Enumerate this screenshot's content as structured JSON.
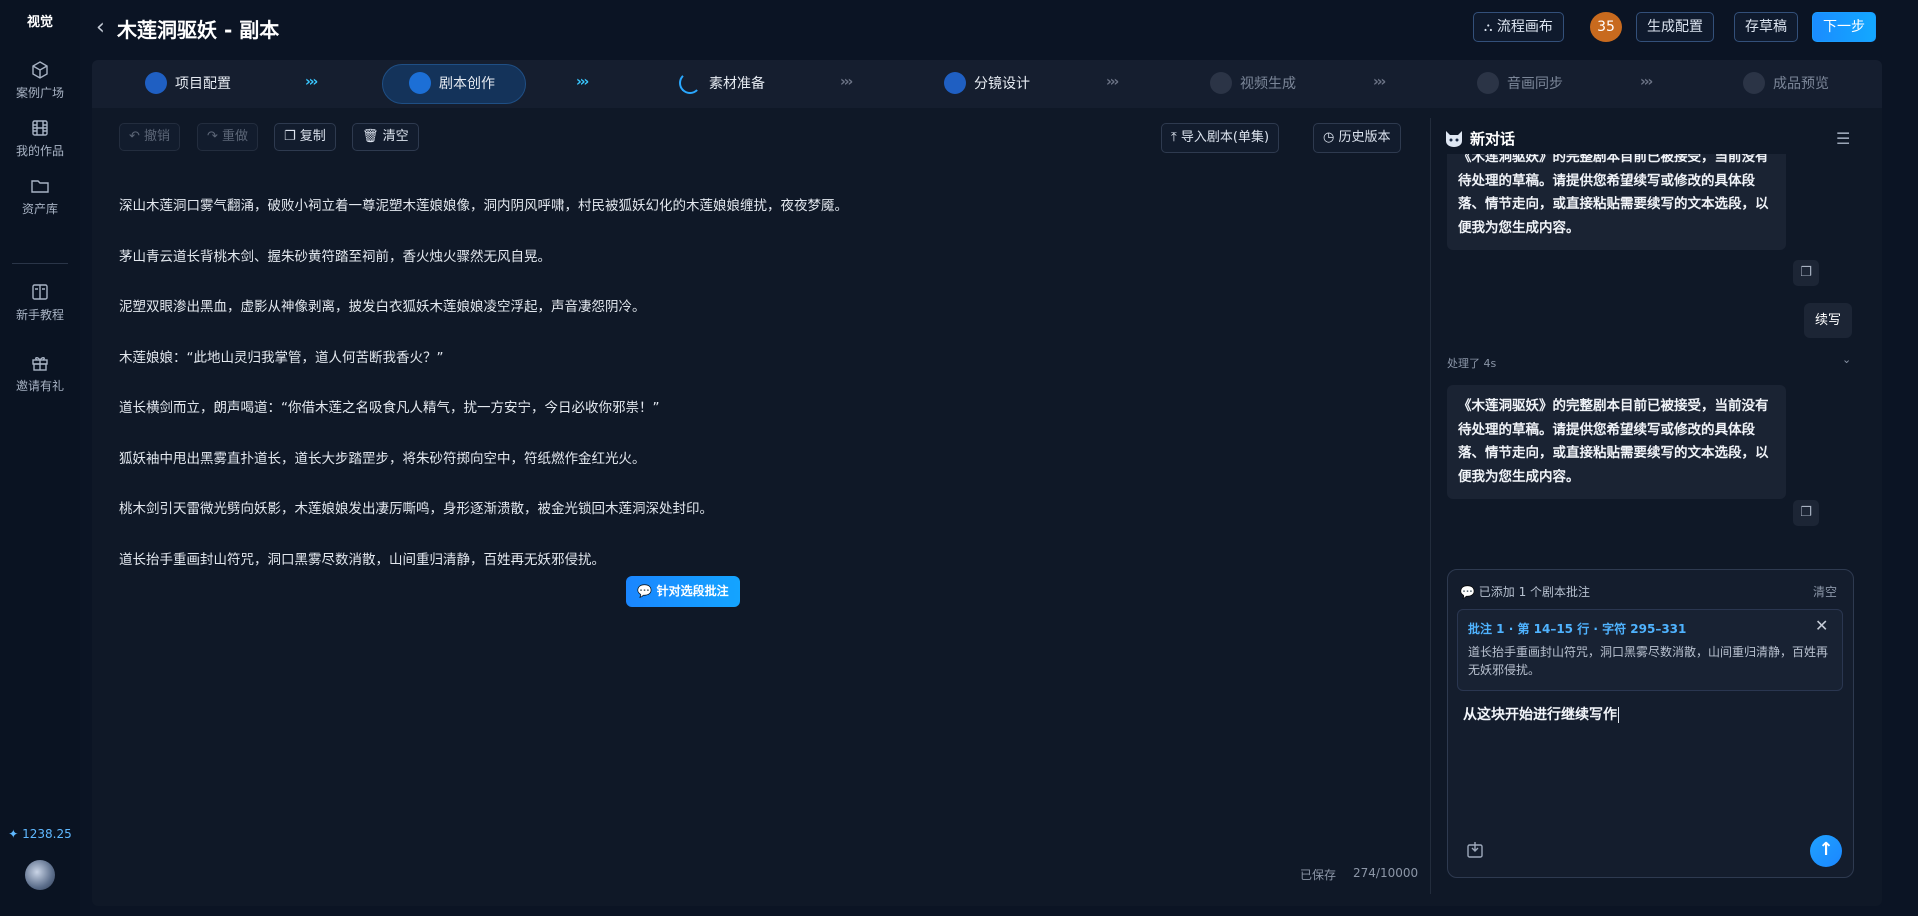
{
  "brand": "视觉",
  "sidebar": {
    "items": [
      {
        "label": "案例广场",
        "icon": "cube-icon"
      },
      {
        "label": "我的作品",
        "icon": "film-icon"
      },
      {
        "label": "资产库",
        "icon": "folder-icon"
      },
      {
        "label": "新手教程",
        "icon": "book-icon"
      },
      {
        "label": "邀请有礼",
        "icon": "gift-icon"
      }
    ],
    "credits": "1238.25"
  },
  "header": {
    "title": "木莲洞驱妖 - 副本",
    "flow_canvas": "流程画布",
    "badge_count": "35",
    "generate_config": "生成配置",
    "save_draft": "存草稿",
    "next_step": "下一步"
  },
  "steps": [
    {
      "label": "项目配置",
      "state": "done"
    },
    {
      "label": "剧本创作",
      "state": "active"
    },
    {
      "label": "素材准备",
      "state": "loading"
    },
    {
      "label": "分镜设计",
      "state": "done"
    },
    {
      "label": "视频生成",
      "state": "pending"
    },
    {
      "label": "音画同步",
      "state": "pending"
    },
    {
      "label": "成品预览",
      "state": "pending"
    }
  ],
  "editor": {
    "toolbar": {
      "undo": "撤销",
      "redo": "重做",
      "copy": "复制",
      "clear": "清空",
      "import": "导入剧本(单集)",
      "history": "历史版本"
    },
    "paragraphs": [
      "深山木莲洞口雾气翻涌，破败小祠立着一尊泥塑木莲娘娘像，洞内阴风呼啸，村民被狐妖幻化的木莲娘娘缠扰，夜夜梦魇。",
      "茅山青云道长背桃木剑、握朱砂黄符踏至祠前，香火烛火骤然无风自晃。",
      "泥塑双眼渗出黑血，虚影从神像剥离，披发白衣狐妖木莲娘娘凌空浮起，声音凄怨阴冷。",
      "木莲娘娘：“此地山灵归我掌管，道人何苦断我香火？”",
      "道长横剑而立，朗声喝道：“你借木莲之名吸食凡人精气，扰一方安宁，今日必收你邪祟！”",
      "狐妖袖中甩出黑雾直扑道长，道长大步踏罡步，将朱砂符掷向空中，符纸燃作金红光火。",
      "桃木剑引天雷微光劈向妖影，木莲娘娘发出凄厉嘶鸣，身形逐渐溃散，被金光锁回木莲洞深处封印。",
      "道长抬手重画封山符咒，洞口黑雾尽数消散，山间重归清静，百姓再无妖邪侵扰。"
    ],
    "annotate_selection": "针对选段批注",
    "save_status": "已保存",
    "char_count": "274/10000"
  },
  "chat": {
    "title": "新对话",
    "assistant_reply_1": "《木莲洞驱妖》的完整剧本目前已被接受，当前没有待处理的草稿。请提供您希望续写或修改的具体段落、情节走向，或直接粘贴需要续写的文本选段，以便我为您生成内容。",
    "user_message": "续写",
    "processed": "处理了 4s",
    "assistant_reply_2": "《木莲洞驱妖》的完整剧本目前已被接受，当前没有待处理的草稿。请提供您希望续写或修改的具体段落、情节走向，或直接粘贴需要续写的文本选段，以便我为您生成内容。",
    "input": {
      "annotations_added": "已添加 1 个剧本批注",
      "clear": "清空",
      "annotation_ref": "批注 1 · 第 14–15 行 · 字符 295–331",
      "annotation_text": "道长抬手重画封山符咒，洞口黑雾尽数消散，山间重归清静，百姓再无妖邪侵扰。",
      "prompt": "从这块开始进行继续写作"
    }
  },
  "colors": {
    "accent": "#1a8cff",
    "badge": "#c86a1e",
    "annotation_ref": "#4fb3ff"
  }
}
